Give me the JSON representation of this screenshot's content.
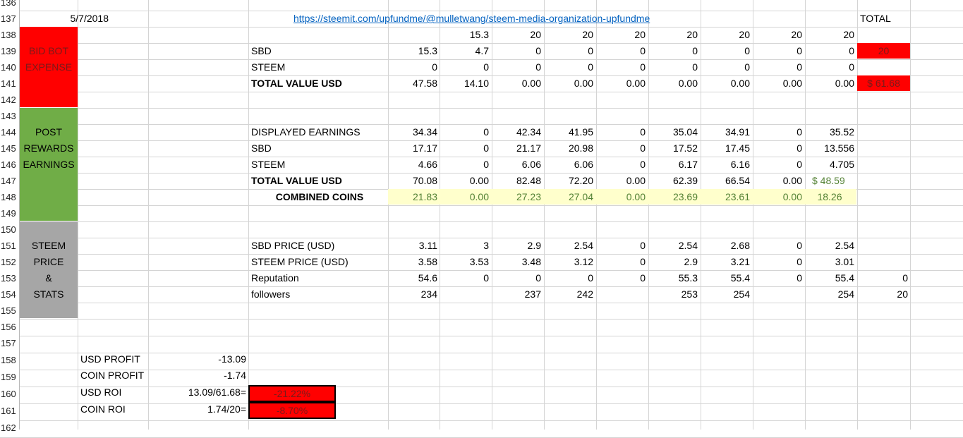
{
  "row_numbers": [
    "136",
    "137",
    "138",
    "139",
    "140",
    "141",
    "142",
    "143",
    "144",
    "145",
    "146",
    "147",
    "148",
    "149",
    "150",
    "151",
    "152",
    "153",
    "154",
    "155",
    "156",
    "157",
    "158",
    "159",
    "160",
    "161",
    "162"
  ],
  "header": {
    "date": "5/7/2018",
    "link": "https://steemit.com/upfundme/@mulletwang/steem-media-organization-upfundme",
    "total_label": "TOTAL"
  },
  "sections": {
    "bid_bot": [
      "BID BOT",
      "EXPENSE"
    ],
    "post_rewards": [
      "POST",
      "REWARDS",
      "EARNINGS"
    ],
    "steem_price": [
      "STEEM",
      "PRICE",
      "&",
      "STATS"
    ]
  },
  "colors": {
    "red": "#ff0000",
    "green": "#70ad47",
    "gray": "#a6a6a6",
    "yellow": "#ffffcc",
    "combined_text": "#548235",
    "link": "#0563c1"
  },
  "bid_top": [
    "",
    "15.3",
    "20",
    "20",
    "20",
    "20",
    "20",
    "20",
    "20"
  ],
  "rows": [
    {
      "label": "SBD",
      "bold": false,
      "values": [
        "15.3",
        "4.7",
        "0",
        "0",
        "0",
        "0",
        "0",
        "0",
        "0"
      ],
      "total": "20"
    },
    {
      "label": "STEEM",
      "bold": false,
      "values": [
        "0",
        "0",
        "0",
        "0",
        "0",
        "0",
        "0",
        "0",
        "0"
      ],
      "total": ""
    },
    {
      "label": "TOTAL VALUE USD",
      "bold": true,
      "values": [
        "47.58",
        "14.10",
        "0.00",
        "0.00",
        "0.00",
        "0.00",
        "0.00",
        "0.00",
        "0.00"
      ],
      "total": "$ 61.68"
    }
  ],
  "earn_rows": [
    {
      "label": "DISPLAYED EARNINGS",
      "bold": false,
      "values": [
        "34.34",
        "0",
        "42.34",
        "41.95",
        "0",
        "35.04",
        "34.91",
        "0",
        "35.52"
      ]
    },
    {
      "label": "SBD",
      "bold": false,
      "values": [
        "17.17",
        "0",
        "21.17",
        "20.98",
        "0",
        "17.52",
        "17.45",
        "0",
        "13.556"
      ]
    },
    {
      "label": "STEEM",
      "bold": false,
      "values": [
        "4.66",
        "0",
        "6.06",
        "6.06",
        "0",
        "6.17",
        "6.16",
        "0",
        "4.705"
      ]
    },
    {
      "label": "TOTAL VALUE USD",
      "bold": true,
      "values": [
        "70.08",
        "0.00",
        "82.48",
        "72.20",
        "0.00",
        "62.39",
        "66.54",
        "0.00",
        "$ 48.59"
      ]
    },
    {
      "label": "COMBINED COINS",
      "bold": true,
      "values": [
        "21.83",
        "0.00",
        "27.23",
        "27.04",
        "0.00",
        "23.69",
        "23.61",
        "0.00",
        "18.26"
      ]
    }
  ],
  "price_rows": [
    {
      "label": "SBD PRICE (USD)",
      "values": [
        "3.11",
        "3",
        "2.9",
        "2.54",
        "0",
        "2.54",
        "2.68",
        "0",
        "2.54"
      ],
      "extra": ""
    },
    {
      "label": "STEEM PRICE (USD)",
      "values": [
        "3.58",
        "3.53",
        "3.48",
        "3.12",
        "0",
        "2.9",
        "3.21",
        "0",
        "3.01"
      ],
      "extra": ""
    },
    {
      "label": "Reputation",
      "values": [
        "54.6",
        "0",
        "0",
        "0",
        "0",
        "55.3",
        "55.4",
        "0",
        "55.4"
      ],
      "extra": "0"
    },
    {
      "label": "followers",
      "values": [
        "234",
        "",
        "237",
        "242",
        "",
        "253",
        "254",
        "",
        "254"
      ],
      "extra": "20"
    }
  ],
  "summary": [
    {
      "label": "USD PROFIT",
      "formula": "-13.09",
      "result": ""
    },
    {
      "label": "COIN PROFIT",
      "formula": "-1.74",
      "result": ""
    },
    {
      "label": "USD ROI",
      "formula": "13.09/61.68=",
      "result": "-21.22%"
    },
    {
      "label": "COIN ROI",
      "formula": "1.74/20=",
      "result": "-8.70%"
    }
  ]
}
